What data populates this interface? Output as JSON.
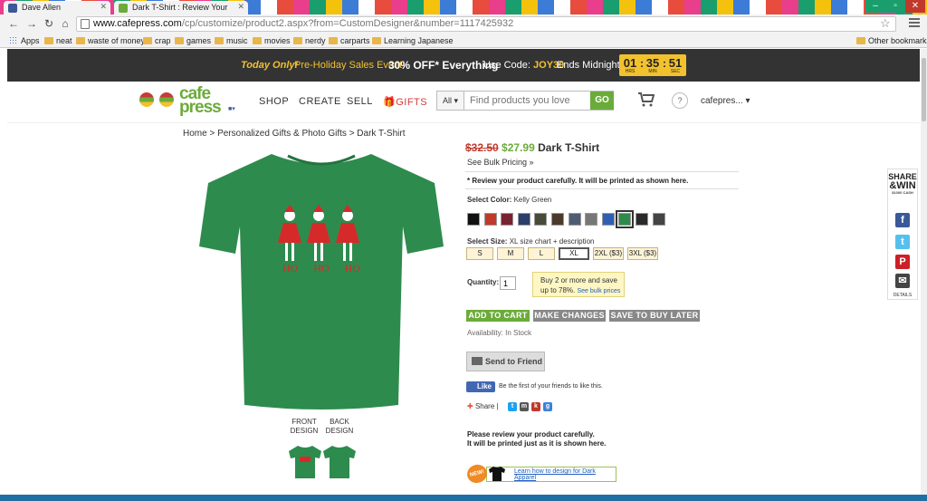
{
  "browser": {
    "tabs": [
      {
        "title": "Dave Allen",
        "favicon_color": "#3b5998"
      },
      {
        "title": "Dark T-Shirt : Review Your",
        "favicon_color": "#6bab3a"
      }
    ],
    "url_host": "www.cafepress.com",
    "url_path": "/cp/customize/product2.aspx?from=CustomDesigner&number=1117425932",
    "bookmarks": [
      "Apps",
      "neat",
      "waste of money",
      "crap",
      "games",
      "music",
      "movies",
      "nerdy",
      "carparts",
      "Learning Japanese"
    ],
    "other_bookmarks": "Other bookmarks"
  },
  "promo": {
    "today": "Today Only!",
    "event": "Pre-Holiday Sales Event!",
    "off": "30% OFF* Everything",
    "code_label": "Use Code:",
    "code": "JOY30",
    "ends": "Ends Midnight",
    "timer": {
      "hrs": "01",
      "min": "35",
      "sec": "51",
      "hrs_label": "HRS",
      "min_label": "MIN",
      "sec_label": "SEC"
    }
  },
  "header": {
    "logo_line1": "cafe",
    "logo_line2": "press",
    "nav": [
      "SHOP",
      "CREATE",
      "SELL",
      "GIFTS"
    ],
    "search_scope": "All",
    "search_placeholder": "Find products you love",
    "search_go": "GO",
    "help": "?",
    "account": "cafepres..."
  },
  "breadcrumb": "Home > Personalized Gifts & Photo Gifts > Dark T-Shirt",
  "shirt": {
    "text": "HO HO HO",
    "color": "#2e8b4e"
  },
  "design_labels": {
    "front": "FRONT\nDESIGN",
    "back": "BACK\nDESIGN"
  },
  "product": {
    "old_price": "$32.50",
    "new_price": "$27.99",
    "name": "Dark T-Shirt",
    "bulk_link": "See Bulk Pricing »",
    "review_note": "* Review your product carefully. It will be printed as shown here.",
    "color_label": "Select Color:",
    "color_value": "Kelly Green",
    "colors": [
      "#111111",
      "#c0392b",
      "#7a2230",
      "#2c3e6b",
      "#4a4a3a",
      "#4b3a2a",
      "#4f5d73",
      "#777777",
      "#2f5fb3",
      "#2e8b4e",
      "#2a2a2a",
      "#444444"
    ],
    "selected_color_index": 9,
    "size_label": "Select Size:",
    "size_value": "XL",
    "size_links": "size chart + description",
    "sizes": [
      "S",
      "M",
      "L",
      "XL",
      "2XL ($3)",
      "3XL ($3)"
    ],
    "selected_size_index": 3,
    "qty_label": "Quantity:",
    "qty_value": "1",
    "bulk_tip_line1": "Buy 2 or more and save",
    "bulk_tip_line2": "up to 78%.",
    "bulk_tip_link": "See bulk prices",
    "add_to_cart": "ADD TO CART",
    "make_changes": "MAKE CHANGES",
    "save_later": "SAVE TO BUY LATER",
    "availability": "Availability: In Stock",
    "send_friend": "Send to Friend",
    "fb_like": "Like",
    "fb_text": "Be the first of your friends to like this.",
    "share": "Share",
    "please_line1": "Please review your product carefully.",
    "please_line2": "It will be printed just as it is shown here.",
    "new_badge": "NEW!",
    "learn_link": "Learn how to design for Dark Apparel"
  },
  "social": {
    "share": "SHARE",
    "win": "&WIN",
    "cash": "$1000 CASH",
    "details": "DETAILS"
  },
  "colors": {
    "brand_green": "#6bab3a",
    "promo_yellow": "#f2c12e",
    "sale_red": "#c0392b"
  }
}
